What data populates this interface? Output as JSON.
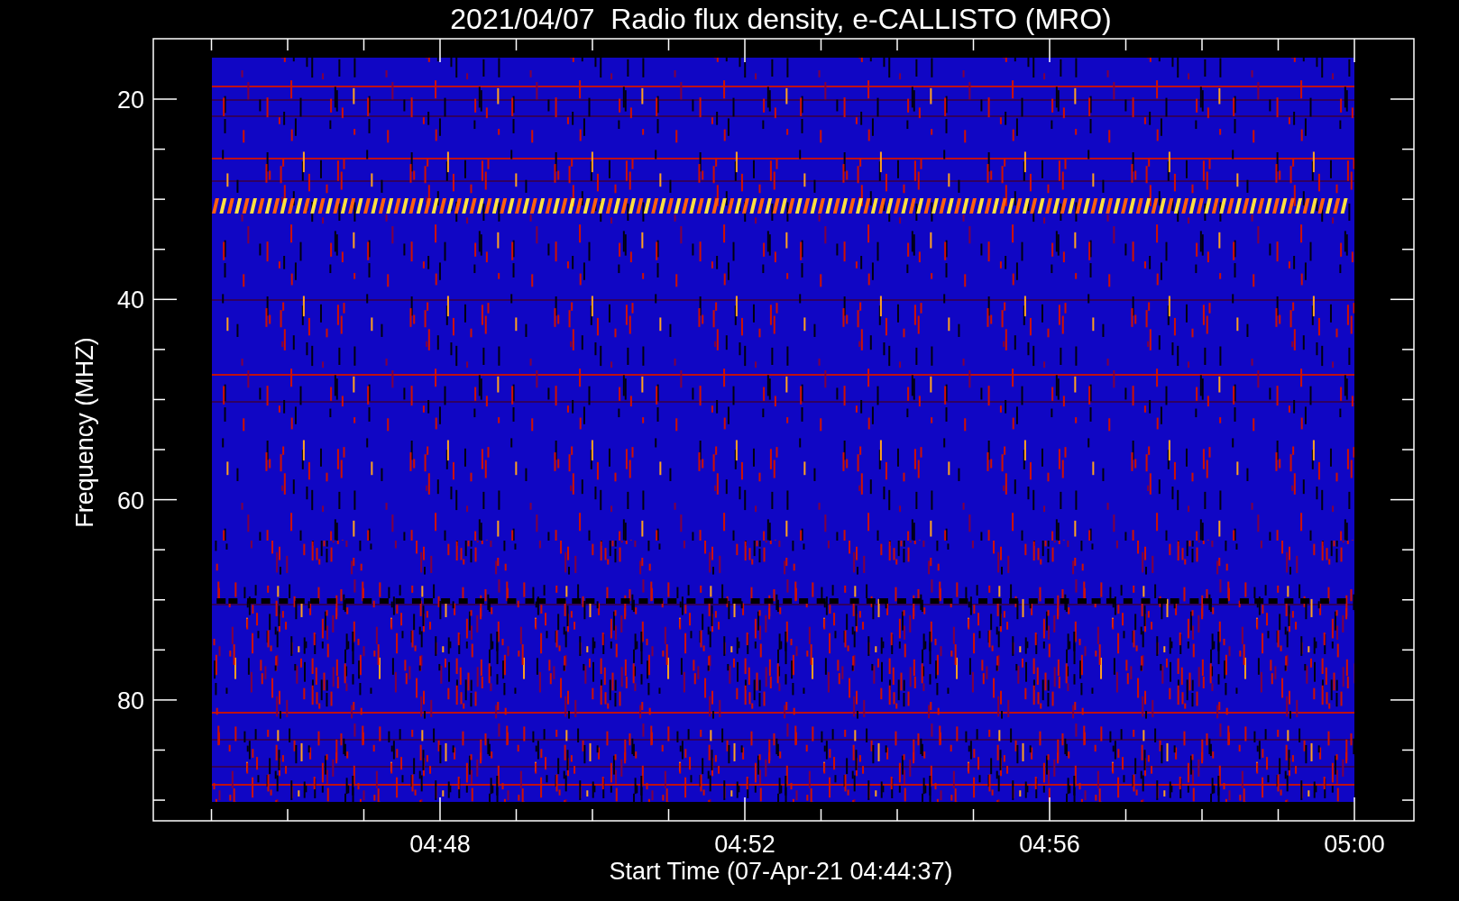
{
  "title": "2021/04/07  Radio flux density, e-CALLISTO (MRO)",
  "y_axis": {
    "label": "Frequency (MHZ)",
    "ticks": [
      "20",
      "40",
      "60",
      "80"
    ]
  },
  "x_axis": {
    "label": "Start Time (07-Apr-21 04:44:37)",
    "ticks": [
      "04:48",
      "04:52",
      "04:56",
      "05:00"
    ]
  },
  "plot": {
    "kind": "spectrogram"
  }
}
